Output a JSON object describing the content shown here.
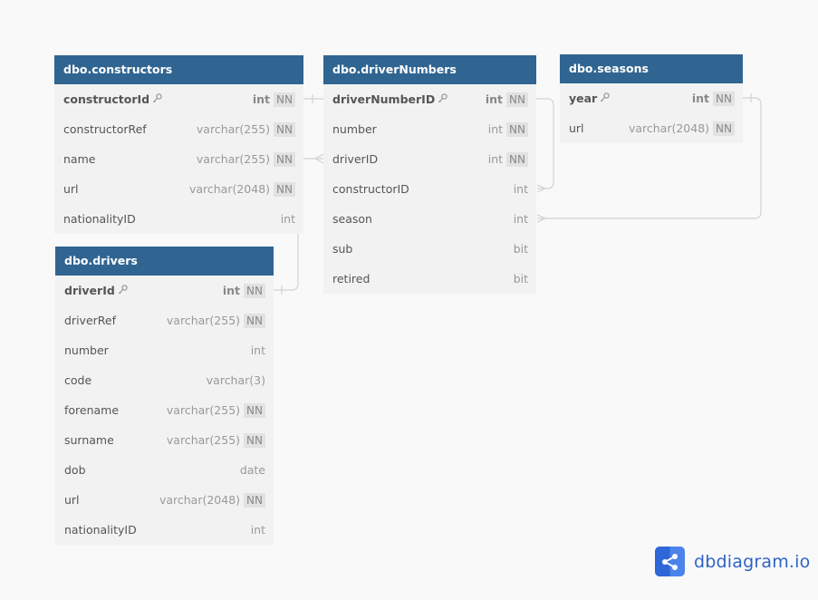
{
  "tables": {
    "constructors": {
      "name": "dbo.constructors",
      "columns": [
        {
          "name": "constructorId",
          "type": "int",
          "nn": "NN",
          "pk": true
        },
        {
          "name": "constructorRef",
          "type": "varchar(255)",
          "nn": "NN"
        },
        {
          "name": "name",
          "type": "varchar(255)",
          "nn": "NN"
        },
        {
          "name": "url",
          "type": "varchar(2048)",
          "nn": "NN"
        },
        {
          "name": "nationalityID",
          "type": "int"
        }
      ]
    },
    "driverNumbers": {
      "name": "dbo.driverNumbers",
      "columns": [
        {
          "name": "driverNumberID",
          "type": "int",
          "nn": "NN",
          "pk": true
        },
        {
          "name": "number",
          "type": "int",
          "nn": "NN"
        },
        {
          "name": "driverID",
          "type": "int",
          "nn": "NN"
        },
        {
          "name": "constructorID",
          "type": "int"
        },
        {
          "name": "season",
          "type": "int"
        },
        {
          "name": "sub",
          "type": "bit"
        },
        {
          "name": "retired",
          "type": "bit"
        }
      ]
    },
    "seasons": {
      "name": "dbo.seasons",
      "columns": [
        {
          "name": "year",
          "type": "int",
          "nn": "NN",
          "pk": true
        },
        {
          "name": "url",
          "type": "varchar(2048)",
          "nn": "NN"
        }
      ]
    },
    "drivers": {
      "name": "dbo.drivers",
      "columns": [
        {
          "name": "driverId",
          "type": "int",
          "nn": "NN",
          "pk": true
        },
        {
          "name": "driverRef",
          "type": "varchar(255)",
          "nn": "NN"
        },
        {
          "name": "number",
          "type": "int"
        },
        {
          "name": "code",
          "type": "varchar(3)"
        },
        {
          "name": "forename",
          "type": "varchar(255)",
          "nn": "NN"
        },
        {
          "name": "surname",
          "type": "varchar(255)",
          "nn": "NN"
        },
        {
          "name": "dob",
          "type": "date"
        },
        {
          "name": "url",
          "type": "varchar(2048)",
          "nn": "NN"
        },
        {
          "name": "nationalityID",
          "type": "int"
        }
      ]
    }
  },
  "relationships": [
    {
      "from": "constructors.constructorId",
      "from_card": "one",
      "to": "driverNumbers.constructorID",
      "to_card": "many"
    },
    {
      "from": "drivers.driverId",
      "from_card": "one",
      "to": "driverNumbers.driverID",
      "to_card": "many"
    },
    {
      "from": "seasons.year",
      "from_card": "one",
      "to": "driverNumbers.season",
      "to_card": "many"
    }
  ],
  "icons": {
    "primary_key": "key-icon",
    "logo": "share-icon"
  },
  "colors": {
    "header": "#306592",
    "body": "#f2f2f2",
    "background": "#f9f9f9",
    "logo": "#2f67d8"
  },
  "brand": {
    "name": "dbdiagram.io"
  }
}
